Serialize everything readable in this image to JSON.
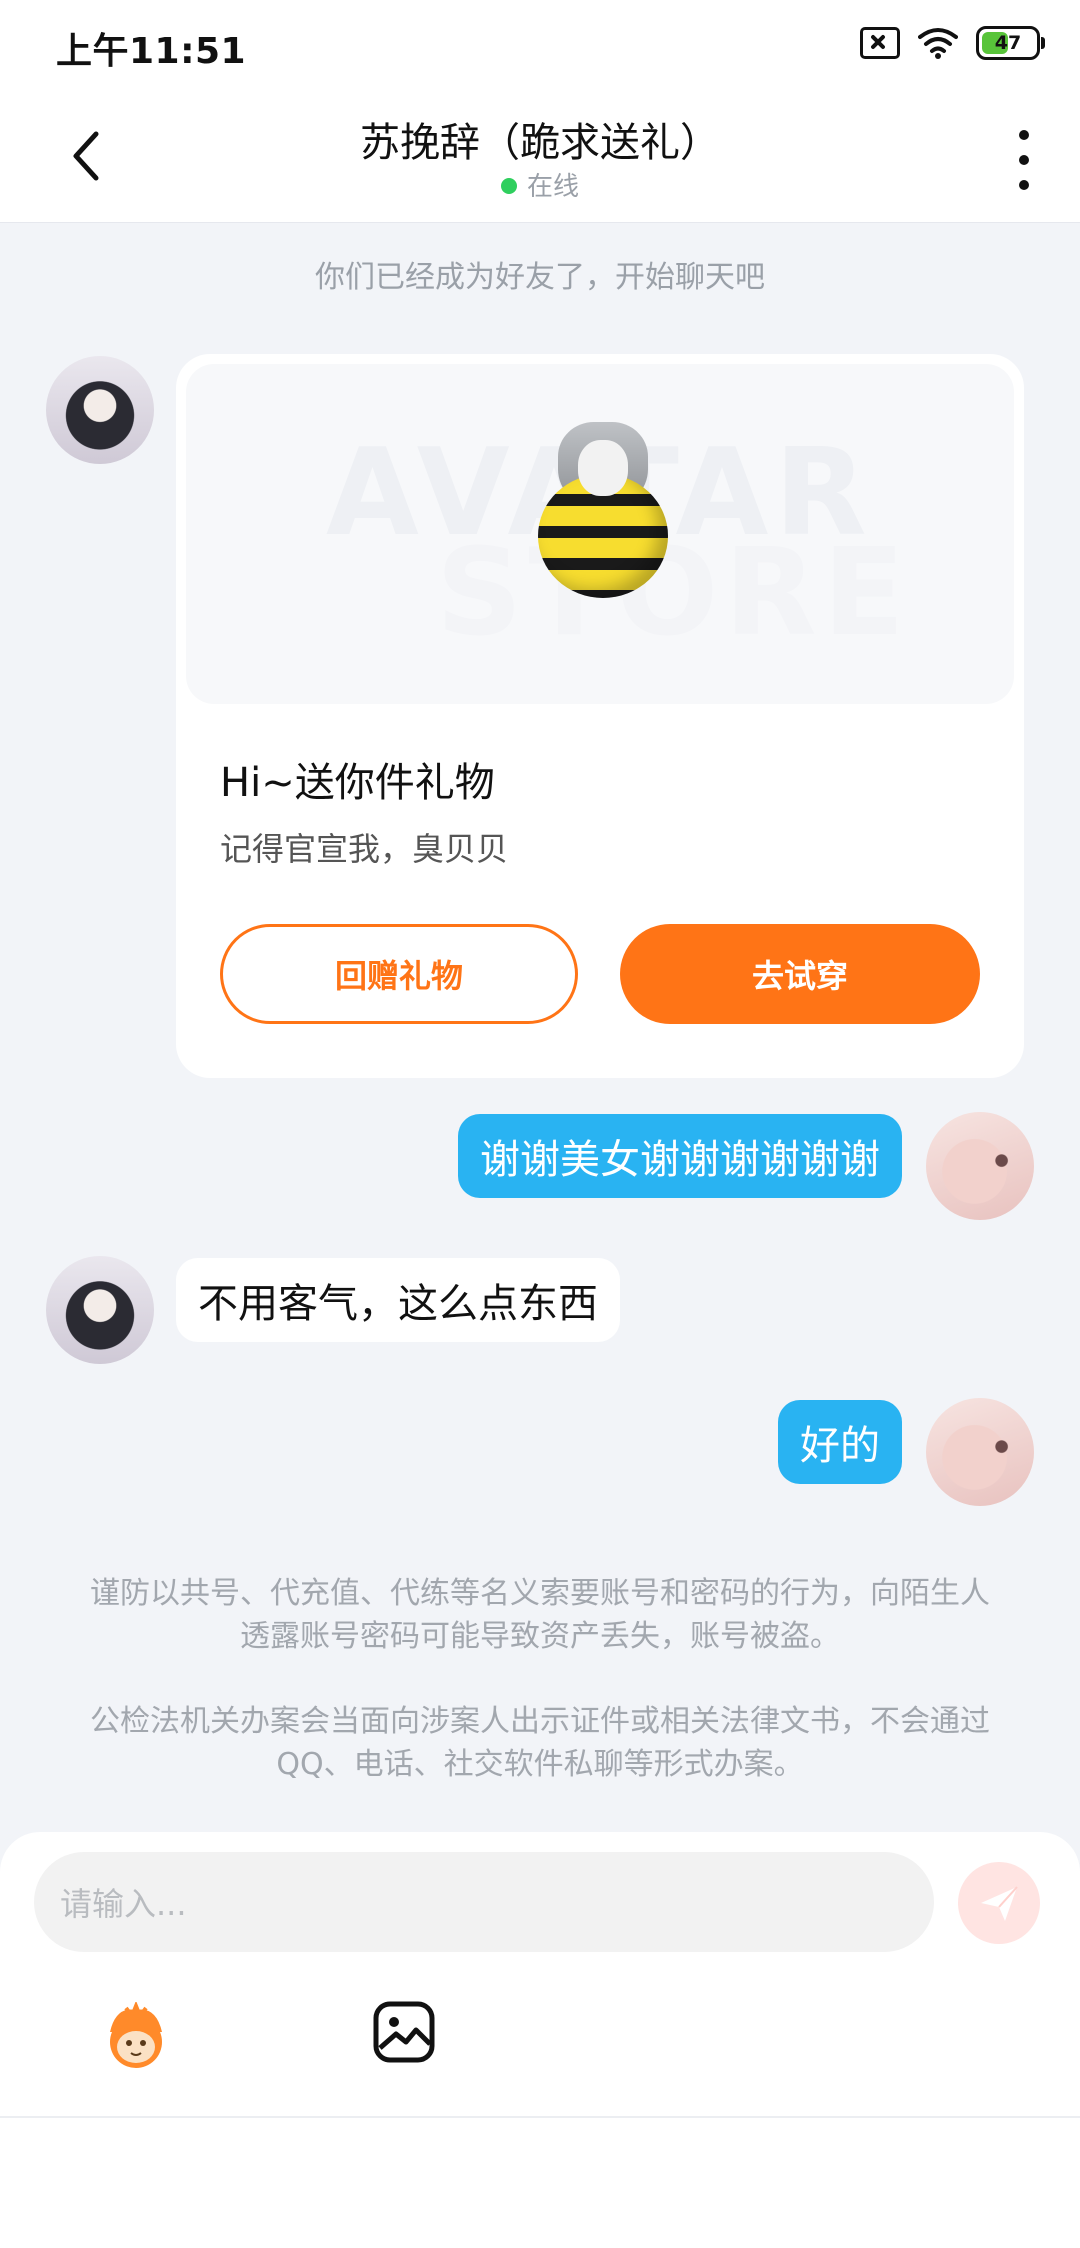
{
  "status_bar": {
    "time": "上午11:51",
    "battery": "47"
  },
  "header": {
    "title": "苏挽辞（跪求送礼）",
    "status": "在线"
  },
  "chat": {
    "system_message": "你们已经成为好友了，开始聊天吧",
    "gift_card": {
      "watermark_line1": "AVATAR",
      "watermark_line2": "STORE",
      "title": "Hi~送你件礼物",
      "subtitle": "记得官宣我，臭贝贝",
      "return_button": "回赠礼物",
      "try_button": "去试穿"
    },
    "messages": [
      {
        "from": "me",
        "text": "谢谢美女谢谢谢谢谢谢"
      },
      {
        "from": "other",
        "text": "不用客气，这么点东西"
      },
      {
        "from": "me",
        "text": "好的"
      }
    ],
    "notices": [
      "谨防以共号、代充值、代练等名义索要账号和密码的行为，向陌生人透露账号密码可能导致资产丢失，账号被盗。",
      "公检法机关办案会当面向涉案人出示证件或相关法律文书，不会通过QQ、电话、社交软件私聊等形式办案。"
    ]
  },
  "input": {
    "placeholder": "请输入..."
  },
  "colors": {
    "accent": "#ff7416",
    "bubble_out": "#29b3f2",
    "online": "#2fcf5e",
    "background": "#f2f4f8"
  },
  "icons": {
    "back": "chevron-left-icon",
    "more": "more-vertical-icon",
    "send": "send-icon",
    "emoji": "emoji-face-icon",
    "image": "image-icon"
  }
}
